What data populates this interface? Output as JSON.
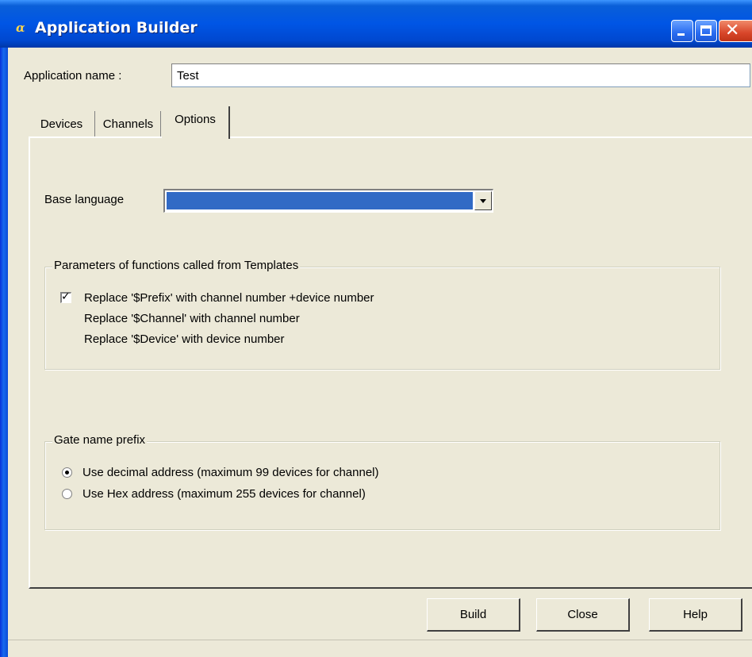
{
  "window": {
    "title": "Application Builder",
    "icon": "alpha-icon",
    "icon_glyph": "α"
  },
  "app_name": {
    "label": "Application name :",
    "value": "Test"
  },
  "tabs": [
    {
      "label": "Devices",
      "active": false
    },
    {
      "label": "Channels",
      "active": false
    },
    {
      "label": "Options",
      "active": true
    }
  ],
  "options": {
    "base_language": {
      "label": "Base language",
      "selected": ""
    },
    "params_group": {
      "title": "Parameters of functions called from Templates",
      "items": [
        {
          "label": "Replace '$Prefix' with channel number +device number",
          "checked": true
        },
        {
          "label": "Replace '$Channel' with channel number"
        },
        {
          "label": "Replace '$Device' with device number"
        }
      ]
    },
    "gate_group": {
      "title": "Gate name prefix",
      "radios": [
        {
          "label": "Use decimal address (maximum 99 devices for channel)",
          "selected": true
        },
        {
          "label": "Use Hex address (maximum 255 devices for channel)",
          "selected": false
        }
      ]
    }
  },
  "buttons": {
    "build": "Build",
    "close": "Close",
    "help": "Help"
  },
  "colors": {
    "titlebar": "#0055e5",
    "face": "#ece9d8",
    "selection": "#316ac5",
    "close_button": "#d8462a"
  }
}
